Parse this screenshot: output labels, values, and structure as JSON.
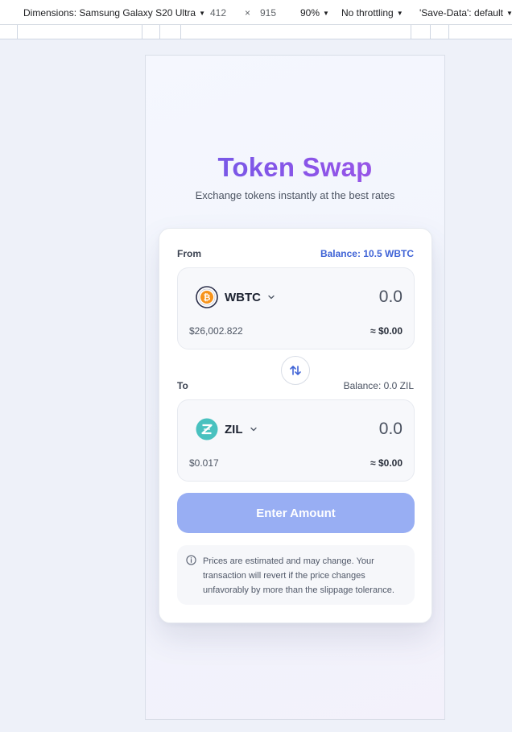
{
  "devtools": {
    "dimensions_label": "Dimensions: Samsung Galaxy S20 Ultra",
    "width": "412",
    "times": "×",
    "height": "915",
    "zoom": "90%",
    "throttling": "No throttling",
    "save_data": "'Save-Data': default"
  },
  "header": {
    "title": "Token Swap",
    "subtitle": "Exchange tokens instantly at the best rates"
  },
  "from": {
    "label": "From",
    "balance": "Balance: 10.5 WBTC",
    "token": "WBTC",
    "amount_placeholder": "0.0",
    "price": "$26,002.822",
    "usd_value": "≈ $0.00",
    "icon": "bitcoin-icon",
    "icon_color": "#f7931a"
  },
  "to": {
    "label": "To",
    "balance": "Balance: 0.0 ZIL",
    "token": "ZIL",
    "amount_placeholder": "0.0",
    "price": "$0.017",
    "usd_value": "≈ $0.00",
    "icon": "zilliqa-icon",
    "icon_color": "#49c1bf"
  },
  "actions": {
    "submit_label": "Enter Amount"
  },
  "notice": {
    "text": "Prices are estimated and may change. Your transaction will revert if the price changes unfavorably by more than the slippage tolerance."
  },
  "colors": {
    "accent": "#3f63d6",
    "button": "#98aef3",
    "title_gradient_start": "#6a5ae6",
    "title_gradient_end": "#a556e6"
  }
}
